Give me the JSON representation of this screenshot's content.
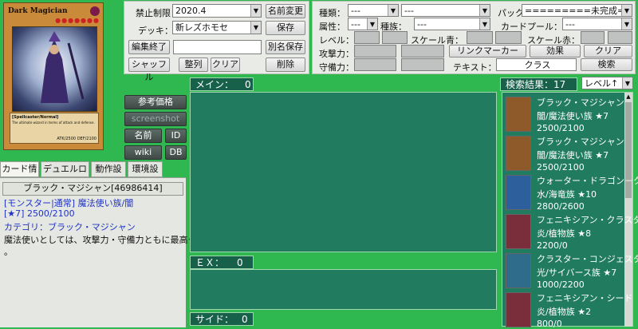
{
  "card_preview": {
    "name": "Dark Magician",
    "type_line": "[Spellcaster/Normal]",
    "flavor": "The ultimate wizard in terms of attack and defense.",
    "atk_def": "ATK/2500  DEF/2100",
    "stars": 7
  },
  "controls": {
    "ban_label": "禁止制限：",
    "ban_value": "2020.4",
    "deck_label": "デッキ：",
    "deck_value": "新レズホモセ",
    "rename_btn": "名前変更",
    "save_btn": "保存",
    "edit_end_btn": "編集終了",
    "save_as_btn": "別名保存",
    "shuffle_btn": "シャッフル",
    "sort_btn": "整列",
    "clear_btn": "クリア",
    "delete_btn": "削除",
    "ref_price_btn": "参考価格",
    "screenshot_btn": "screenshot",
    "name_btn": "名前",
    "id_btn": "ID",
    "wiki_btn": "wiki",
    "db_btn": "DB"
  },
  "filters": {
    "type_label": "種類：",
    "type_value": "---",
    "type2_value": "---",
    "pack_label": "パック",
    "pack_value": "=========未完成========",
    "attr_label": "属性：",
    "attr_value": "---",
    "race_label": "種族：",
    "race_value": "---",
    "pool_label": "カードプール：",
    "pool_value": "---",
    "level_label": "レベル：",
    "scale_blue_label": "スケール青：",
    "scale_red_label": "スケール赤：",
    "atk_label": "攻撃力：",
    "def_label": "守備力：",
    "link_marker_btn": "リンクマーカー",
    "effect_btn": "効果",
    "clear_btn": "クリア",
    "text_label": "テキスト：",
    "text_value": "クラス",
    "search_btn": "検索"
  },
  "zones": {
    "main_label": "メイン：",
    "main_count": "0",
    "ex_label": "ＥＸ：",
    "ex_count": "0",
    "side_label": "サイド：",
    "side_count": "0"
  },
  "tabs": [
    "カード情報",
    "デュエルログ",
    "動作設定",
    "環境設定"
  ],
  "card_info": {
    "title": "ブラック・マジシャン[46986414]",
    "line1": "[モンスター|通常] 魔法使い族/闇",
    "line2": "[★7] 2500/2100",
    "line3": "カテゴリ：ブラック・マジシャン",
    "line4": "魔法使いとしては、攻撃力・守備力ともに最高クラス",
    "line5": "。"
  },
  "results": {
    "label": "検索結果：17",
    "sort_value": "レベル↑",
    "items": [
      {
        "name": "ブラック・マジシャン",
        "type": "闇/魔法使い族 ★7",
        "stats": "2500/2100",
        "color": "#8e5a2a"
      },
      {
        "name": "ブラック・マジシャン",
        "type": "闇/魔法使い族 ★7",
        "stats": "2500/2100",
        "color": "#8e5a2a"
      },
      {
        "name": "ウォーター・ドラゴン－クラ",
        "type": "水/海竜族 ★10",
        "stats": "2800/2600",
        "color": "#2d5f9c"
      },
      {
        "name": "フェニキシアン・クラスター",
        "type": "炎/植物族 ★8",
        "stats": "2200/0",
        "color": "#7a2d3a"
      },
      {
        "name": "クラスター・コンジェスター",
        "type": "光/サイバース族 ★7",
        "stats": "1000/2200",
        "color": "#2f6b8a"
      },
      {
        "name": "フェニキシアン・シード",
        "type": "炎/植物族 ★2",
        "stats": "800/0",
        "color": "#7a2d3a"
      }
    ]
  }
}
